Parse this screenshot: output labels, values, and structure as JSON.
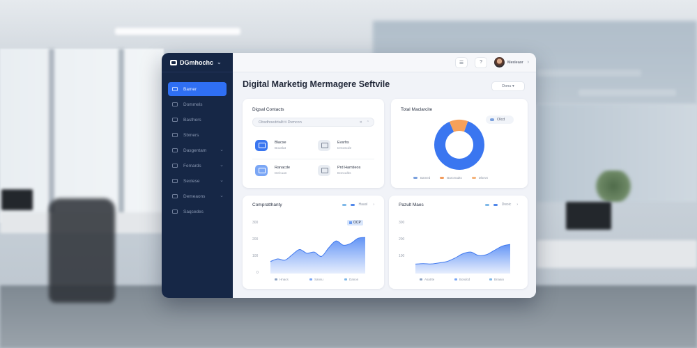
{
  "colors": {
    "sidebar_bg": "#162746",
    "accent": "#2f6ff3",
    "donut_blue": "#3a76f0",
    "donut_orange": "#f6a15a",
    "chart_fill_top": "#5b8ff5",
    "chart_fill_bottom": "#e4ecfd",
    "legend_blue": "#7aa0dd",
    "legend_orange": "#f29b5c",
    "legend_light_orange": "#f4b37a",
    "legend_teal": "#7fb8e8"
  },
  "app": {
    "brand": "DGmhochc",
    "brand_chevron": "chevron-down-icon"
  },
  "sidebar": {
    "items": [
      {
        "label": "Bamer",
        "active": true
      },
      {
        "label": "Dommels"
      },
      {
        "label": "Basthers"
      },
      {
        "label": "Sbmers"
      },
      {
        "label": "Dasgentam",
        "chevron": true
      },
      {
        "label": "Femards",
        "chevron": true
      },
      {
        "label": "Sextese",
        "chevron": true
      },
      {
        "label": "Demeaons",
        "chevron": true
      },
      {
        "label": "Saqcedes"
      }
    ]
  },
  "topbar": {
    "icons": [
      "menu-icon",
      "help-icon"
    ],
    "user_name": "Mexleaor"
  },
  "page": {
    "title": "Digital Marketig Mermagere Seftvile",
    "select_label": "Donu ▾"
  },
  "card_contacts": {
    "title": "Digsal Contacts",
    "search_placeholder": "Obsdhoedrtallt ti Dvmcon",
    "search_clear": "✕",
    "search_chevron": "⌃",
    "tiles": [
      {
        "title": "Blacse",
        "sub": "Bouslat"
      },
      {
        "title": "Evsrhs",
        "sub": "Dmoscde"
      },
      {
        "title": "Ranacde",
        "sub": "Delcuan"
      },
      {
        "title": "Prd Hamtieos",
        "sub": "Boncaltis"
      }
    ]
  },
  "card_donut": {
    "title": "Total Maclarcite",
    "chip_label": "Olcd",
    "legend": [
      "Bamed",
      "Barcmadts",
      "Dlsrsrt"
    ]
  },
  "card_area1": {
    "title": "Compratthanty",
    "legend_label": "Haasl",
    "tag_label": "OCP",
    "yticks": [
      "300",
      "200",
      "100",
      "0"
    ],
    "xlabels": [
      "Hnacs",
      "Sansu",
      "Danon"
    ]
  },
  "card_area2": {
    "title": "Pazult Maes",
    "legend_label": "Dwoic",
    "yticks": [
      "300",
      "200",
      "100"
    ],
    "xlabels": [
      "Asatrte",
      "Bondcd",
      "Bnaaio"
    ]
  },
  "chart_data": [
    {
      "type": "pie",
      "title": "Total Maclarcite",
      "values": [
        88,
        12
      ],
      "labels": [
        "",
        ""
      ],
      "donut": true,
      "legend": [
        "Bamed",
        "Barcmadts",
        "Dlsrsrt"
      ]
    },
    {
      "type": "area",
      "title": "Compratthanty",
      "x": [
        0,
        1,
        2,
        3,
        4,
        5,
        6,
        7,
        8,
        9,
        10,
        11,
        12,
        13
      ],
      "values": [
        70,
        85,
        78,
        110,
        140,
        118,
        125,
        100,
        150,
        190,
        165,
        175,
        205,
        210
      ],
      "ylim": [
        0,
        300
      ],
      "yticks": [
        "300",
        "200",
        "100",
        "0"
      ],
      "xlabels": [
        "Hnacs",
        "Sansu",
        "Danon"
      ]
    },
    {
      "type": "area",
      "title": "Pazult Maes",
      "x": [
        0,
        1,
        2,
        3,
        4,
        5,
        6,
        7,
        8,
        9,
        10,
        11,
        12
      ],
      "values": [
        55,
        58,
        56,
        62,
        70,
        90,
        115,
        125,
        105,
        110,
        135,
        160,
        170
      ],
      "ylim": [
        0,
        300
      ],
      "yticks": [
        "300",
        "200",
        "100"
      ],
      "xlabels": [
        "Asatrte",
        "Bondcd",
        "Bnaaio"
      ]
    }
  ]
}
